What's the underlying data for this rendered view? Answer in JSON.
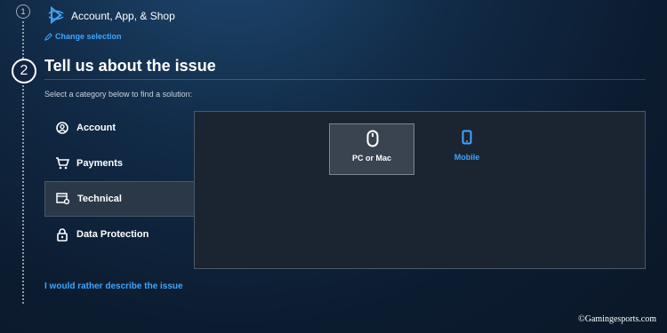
{
  "steps": {
    "step1": {
      "number": "1",
      "title": "Account, App, & Shop",
      "change_label": "Change selection"
    },
    "step2": {
      "number": "2",
      "title": "Tell us about the issue",
      "subtitle": "Select a category below to find a solution:"
    }
  },
  "categories": [
    {
      "label": "Account",
      "icon": "user-circle-icon"
    },
    {
      "label": "Payments",
      "icon": "cart-icon"
    },
    {
      "label": "Technical",
      "icon": "window-gear-icon",
      "selected": true
    },
    {
      "label": "Data Protection",
      "icon": "lock-icon"
    }
  ],
  "platforms": [
    {
      "label": "PC or Mac",
      "icon": "mouse-icon",
      "selected": true
    },
    {
      "label": "Mobile",
      "icon": "mobile-icon"
    }
  ],
  "describe_link": "I would rather describe the issue",
  "watermark": "©Gamingesports.com",
  "colors": {
    "accent": "#3fa6ff",
    "background": "#112a46",
    "panel": "#1b2431",
    "selected_tile": "#3a4350"
  }
}
